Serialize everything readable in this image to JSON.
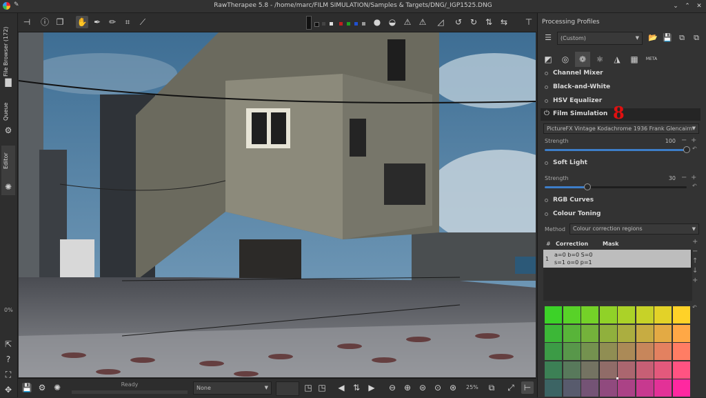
{
  "window": {
    "title": "RawTherapee 5.8 - /home/marc/FILM SIMULATION/Samples & Targets/DNG/_IGP1525.DNG"
  },
  "left_tabs": {
    "file_browser": "File Browser (172)",
    "queue": "Queue",
    "editor": "Editor",
    "percent": "0%"
  },
  "bottom": {
    "status": "Ready",
    "profile_combo": "None",
    "zoom": "25%"
  },
  "right": {
    "processing_profiles_title": "Processing Profiles",
    "profile_value": "(Custom)",
    "tools": {
      "channel_mixer": "Channel Mixer",
      "black_and_white": "Black-and-White",
      "hsv_equalizer": "HSV Equalizer",
      "film_simulation": "Film Simulation",
      "film_select": "PictureFX Vintage Kodachrome 1936 Frank Glencairn",
      "strength_label": "Strength",
      "strength_value": "100",
      "soft_light": "Soft Light",
      "soft_strength_label": "Strength",
      "soft_strength_value": "30",
      "rgb_curves": "RGB Curves",
      "colour_toning": "Colour Toning",
      "method_label": "Method",
      "method_value": "Colour correction regions",
      "col_hash": "#",
      "col_correction": "Correction",
      "col_mask": "Mask",
      "row_index": "1",
      "row_line1": "a=0 b=0 S=0",
      "row_line2": "s=1 o=0 p=1"
    },
    "annotation": "8",
    "meta_tab": "META"
  },
  "sliders": {
    "film_strength_fraction": 1.0,
    "soft_light_fraction": 0.3
  },
  "colors": {
    "accent": "#3d7ec9",
    "annotation_red": "#e01010"
  }
}
